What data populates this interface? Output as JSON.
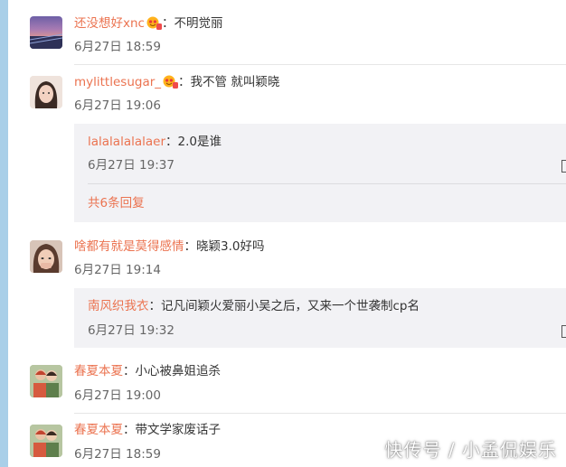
{
  "comments": [
    {
      "username": "还没想好xnc",
      "text": "不明觉丽",
      "time": "6月27日 18:59",
      "has_badge": true
    },
    {
      "username": "mylittlesugar_",
      "text": "我不管 就叫颖晓",
      "time": "6月27日 19:06",
      "has_badge": true,
      "replies": [
        {
          "username": "lalalalalalaer",
          "text": "2.0是谁",
          "time": "6月27日 19:37"
        }
      ],
      "more_replies": "共6条回复"
    },
    {
      "username": "啥都有就是莫得感情",
      "text": "晓颖3.0好吗",
      "time": "6月27日 19:14",
      "has_badge": false,
      "replies": [
        {
          "username": "南风织我衣",
          "text": "记凡间颖火爱丽小吴之后，又来一个世袭制cp名",
          "time": "6月27日 19:32"
        }
      ]
    },
    {
      "username": "春夏本夏",
      "text": "小心被鼻姐追杀",
      "time": "6月27日 19:00",
      "has_badge": false
    },
    {
      "username": "春夏本夏",
      "text": "带文学家废话子",
      "time": "6月27日 18:59",
      "has_badge": false
    }
  ],
  "colon": "：",
  "watermark": "快传号 / 小孟侃娱乐",
  "colors": {
    "username": "#eb7350",
    "reply_bg": "#f2f2f5",
    "left_strip": "#a9cfe8"
  }
}
